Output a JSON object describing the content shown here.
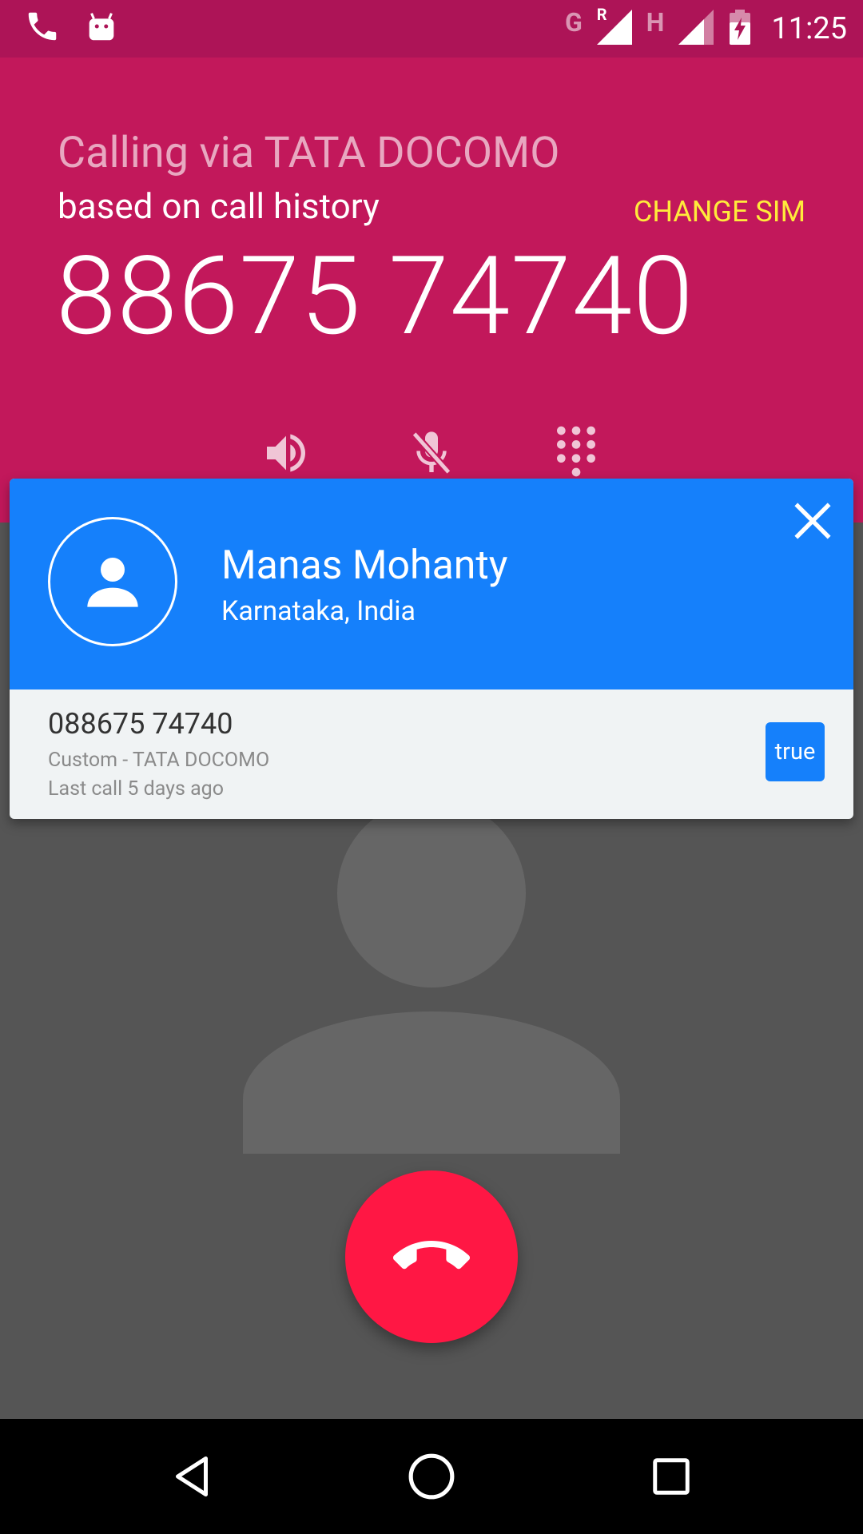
{
  "status_bar": {
    "icons": [
      "phone-call-icon",
      "android-icon",
      "network-g-icon",
      "roaming-signal-icon",
      "network-h-icon",
      "signal-icon",
      "battery-charging-icon"
    ],
    "network_1": "G",
    "roaming": "R",
    "network_2": "H",
    "time": "11:25"
  },
  "call_header": {
    "calling_via": "Calling via TATA DOCOMO",
    "sim_reason": "based on call history",
    "change_sim_label": "CHANGE SIM",
    "number": "88675 74740",
    "controls": [
      "speaker-icon",
      "mute-mic-icon",
      "dialpad-icon"
    ]
  },
  "caller_card": {
    "name": "Manas Mohanty",
    "location": "Karnataka, India",
    "number": "088675 74740",
    "label": "Custom - TATA DOCOMO",
    "last_call": "Last call 5 days ago",
    "badge": "true",
    "close_icon": "close-icon"
  },
  "end_call": {
    "icon": "end-call-icon"
  },
  "nav_bar": {
    "icons": [
      "back-icon",
      "home-icon",
      "recents-icon"
    ]
  },
  "colors": {
    "status_bar": "#AD1457",
    "header": "#C2185B",
    "accent_yellow": "#FFEB3B",
    "card_blue": "#1580FB",
    "end_call_red": "#FF1744",
    "background": "#555555"
  }
}
